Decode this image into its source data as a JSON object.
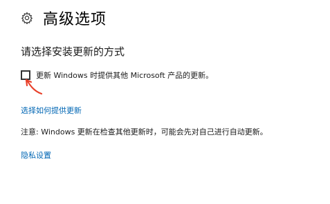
{
  "header": {
    "icon": "gear-icon",
    "title": "高级选项"
  },
  "section": {
    "title": "请选择安装更新的方式"
  },
  "option": {
    "checked": false,
    "label": "更新 Windows 时提供其他 Microsoft 产品的更新。"
  },
  "links": {
    "choose_how": "选择如何提供更新",
    "privacy": "隐私设置"
  },
  "notice": {
    "text": "注意: Windows 更新在检查其他更新时，可能会先对自己进行自动更新。"
  },
  "colors": {
    "link": "#0066b4",
    "arrow": "#e8402a",
    "text": "#1a1a1a"
  }
}
